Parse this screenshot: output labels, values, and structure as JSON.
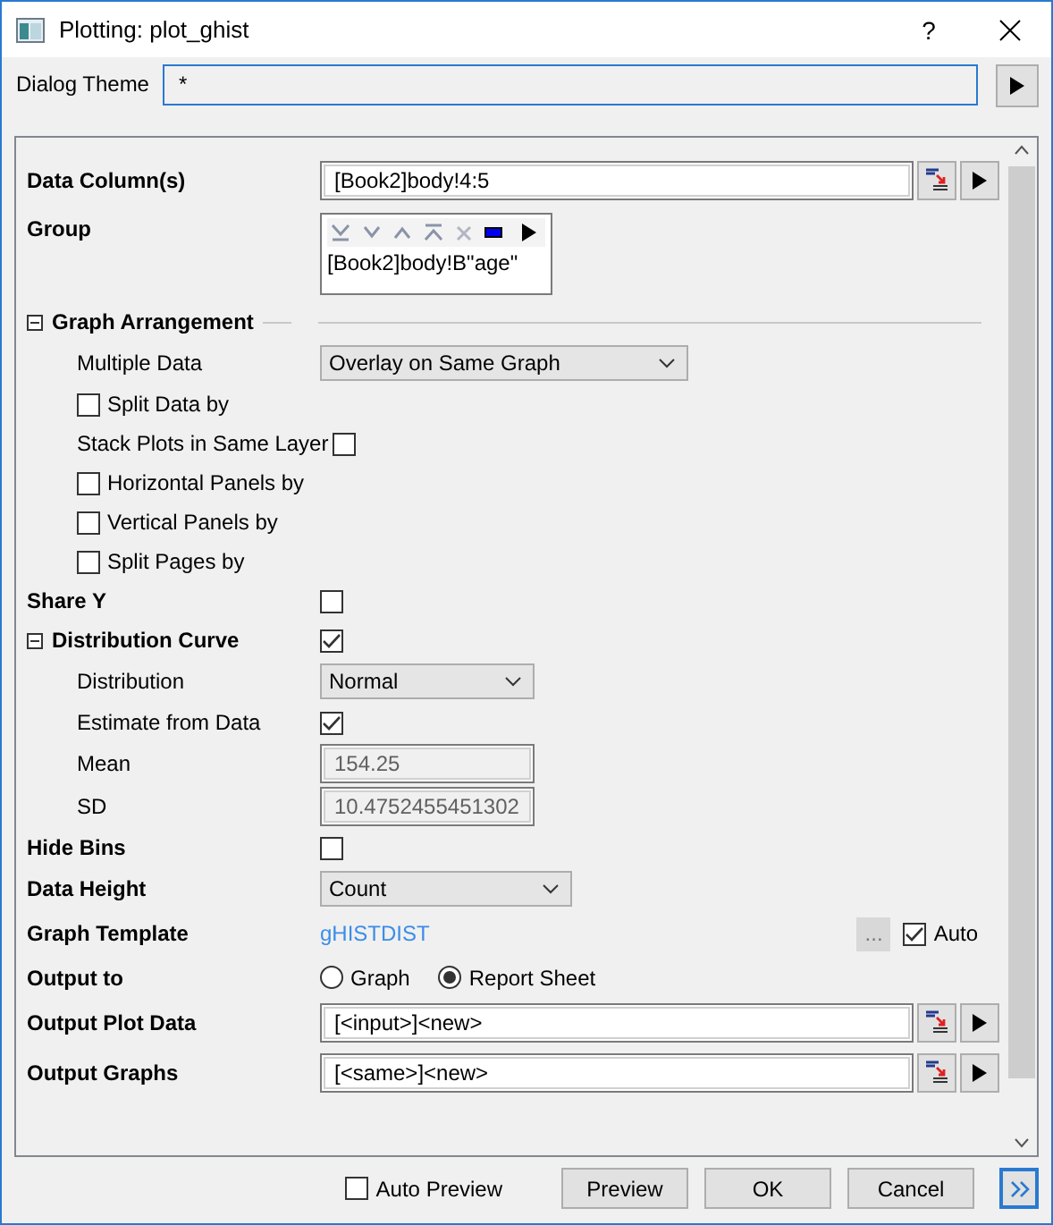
{
  "window": {
    "title": "Plotting: plot_ghist",
    "help": "?"
  },
  "theme": {
    "label": "Dialog Theme",
    "value": "*"
  },
  "rows": [
    {
      "kind": "field",
      "label": "Data Column(s)",
      "value": "[Book2]body!4:5"
    },
    {
      "kind": "group",
      "label": "Group",
      "value": "[Book2]body!B\"age\""
    },
    {
      "kind": "section",
      "label": "Graph Arrangement",
      "expanded": true,
      "children": [
        {
          "kind": "dropdown",
          "label": "Multiple Data",
          "value": "Overlay on Same Graph"
        },
        {
          "kind": "check-left",
          "label": "Split Data by",
          "checked": false
        },
        {
          "kind": "check",
          "label": "Stack Plots in Same Layer",
          "checked": false
        },
        {
          "kind": "check-left",
          "label": "Horizontal Panels by",
          "checked": false
        },
        {
          "kind": "check-left",
          "label": "Vertical Panels by",
          "checked": false
        },
        {
          "kind": "check-left",
          "label": "Split Pages by",
          "checked": false
        }
      ]
    },
    {
      "kind": "check",
      "label": "Share Y",
      "checked": false
    },
    {
      "kind": "section",
      "label": "Distribution Curve",
      "expanded": true,
      "checked": true,
      "children": [
        {
          "kind": "dropdown",
          "label": "Distribution",
          "value": "Normal"
        },
        {
          "kind": "check",
          "label": "Estimate from Data",
          "checked": true
        },
        {
          "kind": "readonly",
          "label": "Mean",
          "value": "154.25"
        },
        {
          "kind": "readonly",
          "label": "SD",
          "value": "10.4752455451302"
        }
      ]
    },
    {
      "kind": "check",
      "label": "Hide Bins",
      "checked": false
    },
    {
      "kind": "dropdown",
      "label": "Data Height",
      "value": "Count"
    },
    {
      "kind": "template",
      "label": "Graph Template",
      "value": "gHISTDIST",
      "browse": "...",
      "auto": {
        "label": "Auto",
        "checked": true
      }
    },
    {
      "kind": "radio",
      "label": "Output to",
      "options": [
        {
          "label": "Graph",
          "selected": false
        },
        {
          "label": "Report Sheet",
          "selected": true
        }
      ]
    },
    {
      "kind": "field",
      "label": "Output Plot Data",
      "value": "[<input>]<new>"
    },
    {
      "kind": "field",
      "label": "Output Graphs",
      "value": "[<same>]<new>"
    }
  ],
  "footer": {
    "auto_preview": {
      "label": "Auto Preview",
      "checked": false
    },
    "buttons": [
      "Preview",
      "OK",
      "Cancel"
    ]
  }
}
